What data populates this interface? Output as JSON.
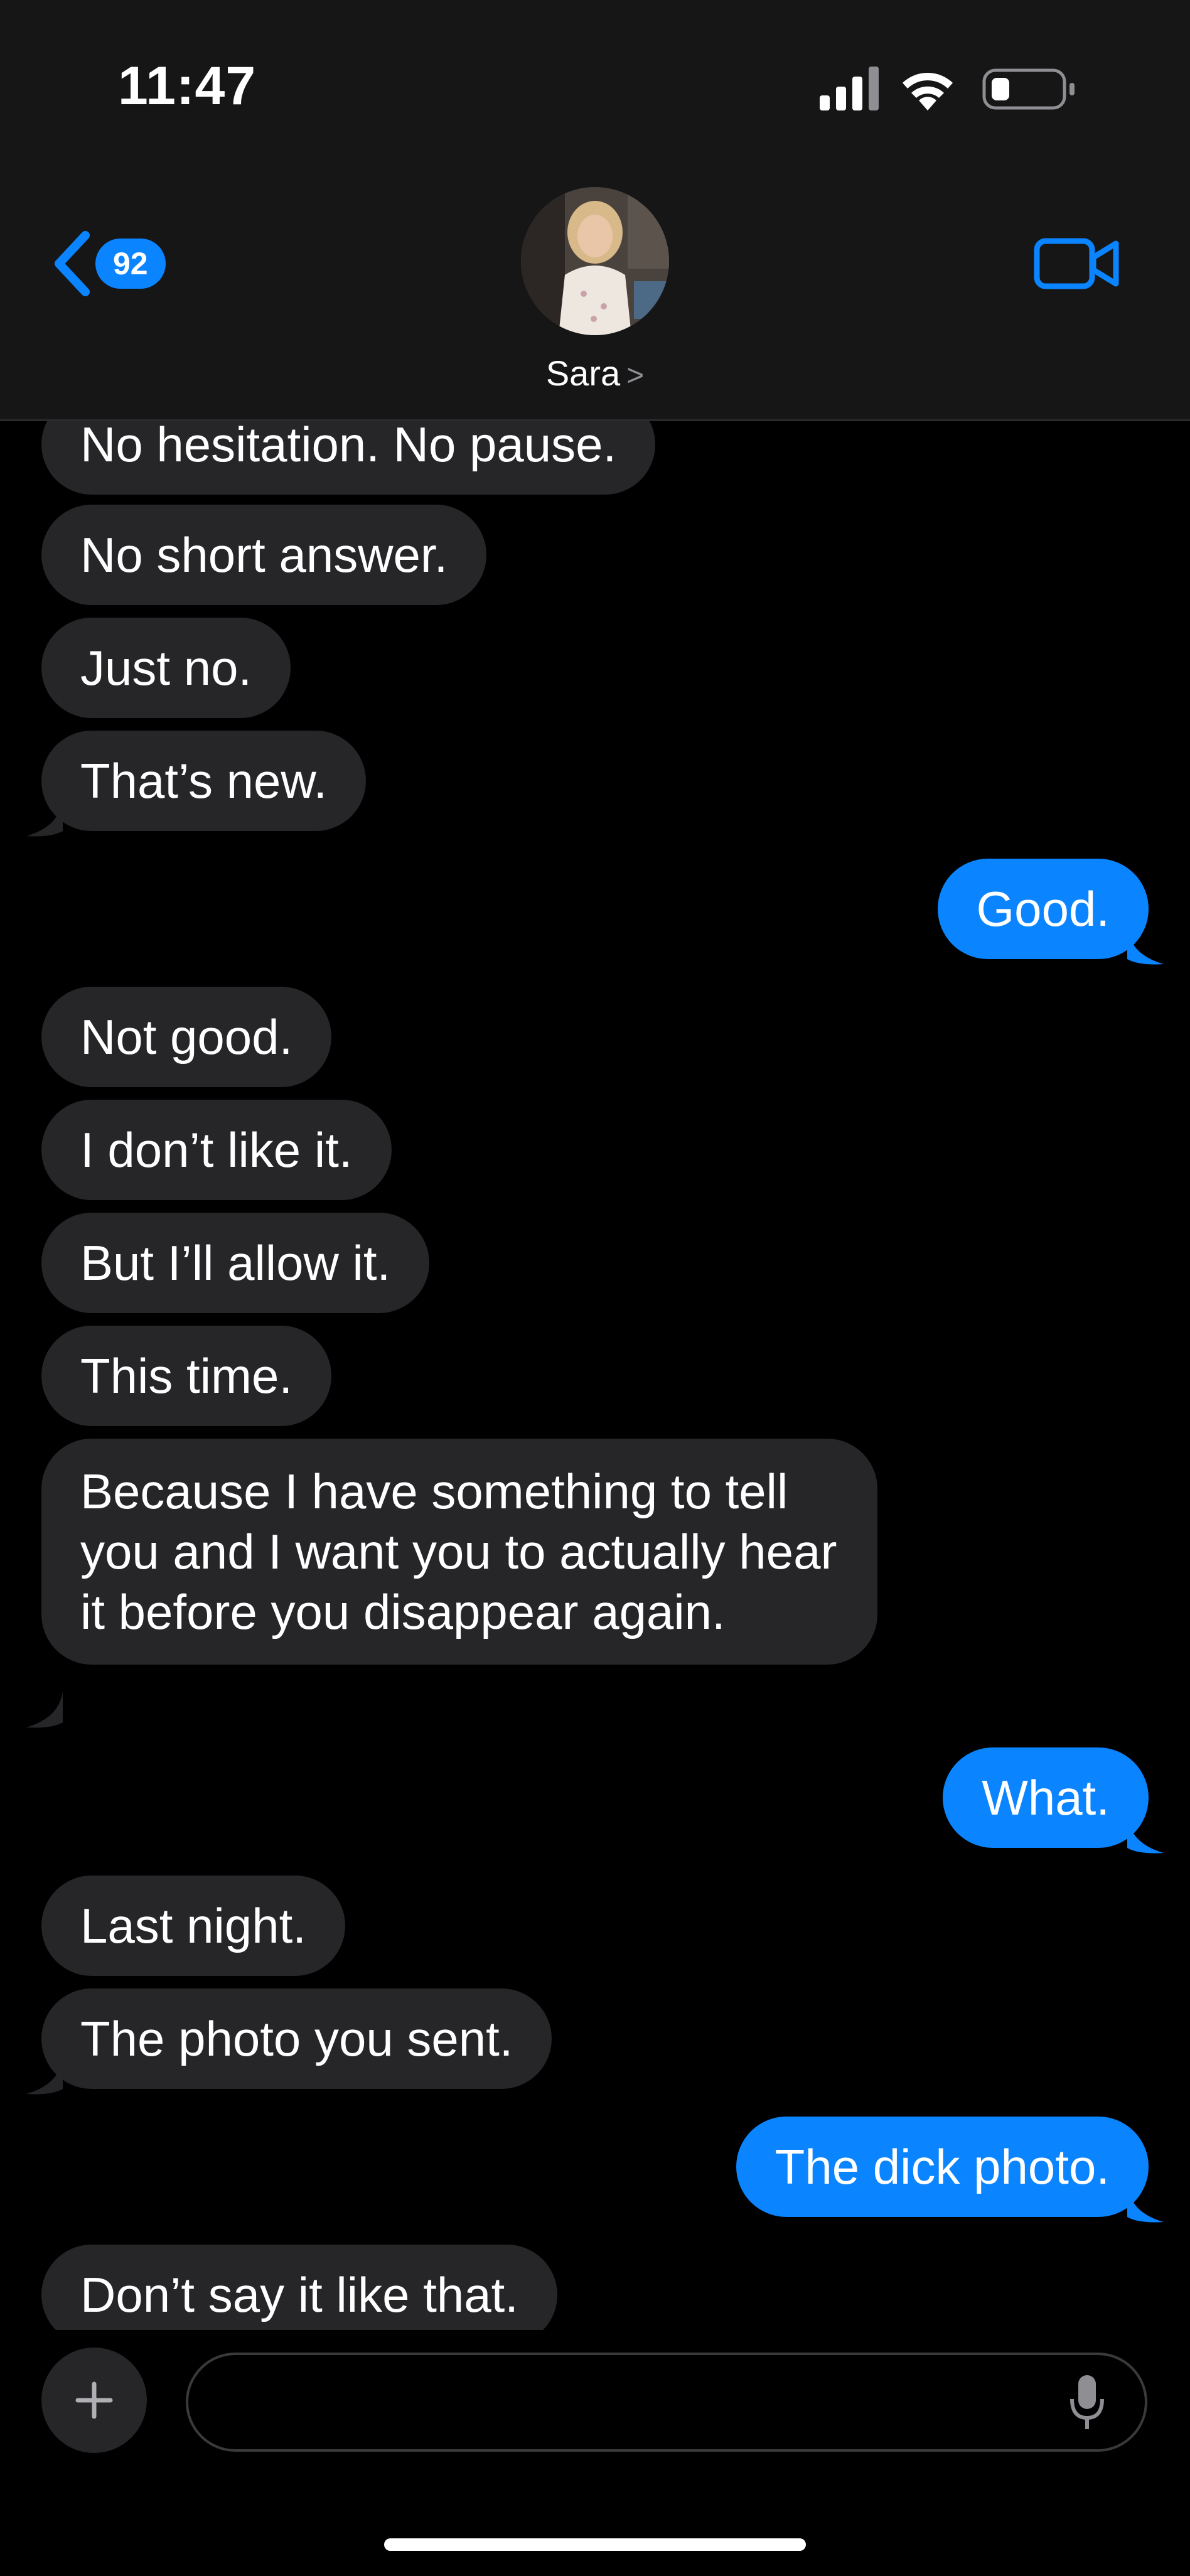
{
  "status_bar": {
    "time": "11:47",
    "icons": [
      "cellular-signal-icon",
      "wifi-icon",
      "battery-icon"
    ]
  },
  "header": {
    "back_badge": "92",
    "contact_name": "Sara",
    "contact_chevron": ">",
    "icons": [
      "back-chevron-icon",
      "video-call-icon"
    ]
  },
  "messages": [
    {
      "from": "contact",
      "text": "No hesitation. No pause."
    },
    {
      "from": "contact",
      "text": "No short answer."
    },
    {
      "from": "contact",
      "text": "Just no."
    },
    {
      "from": "contact",
      "text": "That’s new."
    },
    {
      "from": "me",
      "text": "Good."
    },
    {
      "from": "contact",
      "text": "Not good."
    },
    {
      "from": "contact",
      "text": "I don’t like it."
    },
    {
      "from": "contact",
      "text": "But I’ll allow it."
    },
    {
      "from": "contact",
      "text": "This time."
    },
    {
      "from": "contact",
      "text": "Because I have something to tell you and I want you to actually hear it before you disappear again."
    },
    {
      "from": "me",
      "text": "What."
    },
    {
      "from": "contact",
      "text": "Last night."
    },
    {
      "from": "contact",
      "text": "The photo you sent."
    },
    {
      "from": "me",
      "text": "The dick photo."
    },
    {
      "from": "contact",
      "text": "Don’t say it like that."
    }
  ],
  "composer": {
    "placeholder": "",
    "icons": [
      "plus-icon",
      "microphone-icon"
    ]
  },
  "colors": {
    "accent": "#0a84ff",
    "incoming_bubble": "#262628",
    "header_bg": "#161617",
    "background": "#000000"
  }
}
